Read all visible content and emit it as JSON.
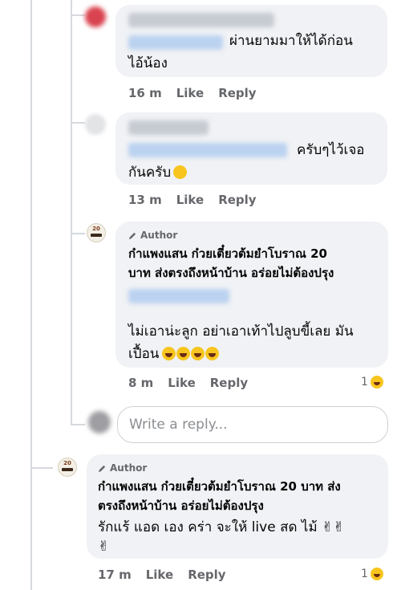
{
  "comments": [
    {
      "time": "16 m",
      "like_label": "Like",
      "reply_label": "Reply",
      "text_line1": "ผ่านยามมาให้ได้ก่อน",
      "text_line2": "ไอ้น้อง"
    },
    {
      "time": "13 m",
      "like_label": "Like",
      "reply_label": "Reply",
      "text_line1": "ครับๆไว้เจอ",
      "text_line2": "กันครับ"
    },
    {
      "author_label": "Author",
      "page_name_line1": "ก๋าแพงแสน ก๋วยเตี๋ยวต้มยำโบราณ 20",
      "page_name_line2": "บาท ส่งตรงถึงหน้าบ้าน อร่อยไม่ต้องปรุง",
      "text_line1": "ไม่เอาน่ะลูก อย่าเอาเท้าไปลูบขี้เลย มัน",
      "text_line2": "เปื้อน",
      "time": "8 m",
      "like_label": "Like",
      "reply_label": "Reply",
      "reaction_count": "1"
    },
    {
      "author_label": "Author",
      "page_name_line1": "ก๋าแพงแสน ก๋วยเตี๋ยวต้มยำโบราณ 20 บาท ส่ง",
      "page_name_line2": "ตรงถึงหน้าบ้าน อร่อยไม่ต้องปรุง",
      "text_line1": "รักแร้ แอด เอง คร่า จะให้ live สด ไม้",
      "time": "17 m",
      "like_label": "Like",
      "reply_label": "Reply",
      "reaction_count": "1"
    }
  ],
  "reply_box": {
    "placeholder": "Write a reply..."
  },
  "logo_text": "20",
  "icons": [
    "pencil-icon",
    "grin-sweat-emoji",
    "laughing-emoji",
    "victory-hand-emoji",
    "haha-reaction-icon"
  ],
  "colors": {
    "bubble": "#f0f2f5",
    "meta": "#65676b",
    "thread": "#d6d9de",
    "blur_tag": "#a9c7ee"
  }
}
